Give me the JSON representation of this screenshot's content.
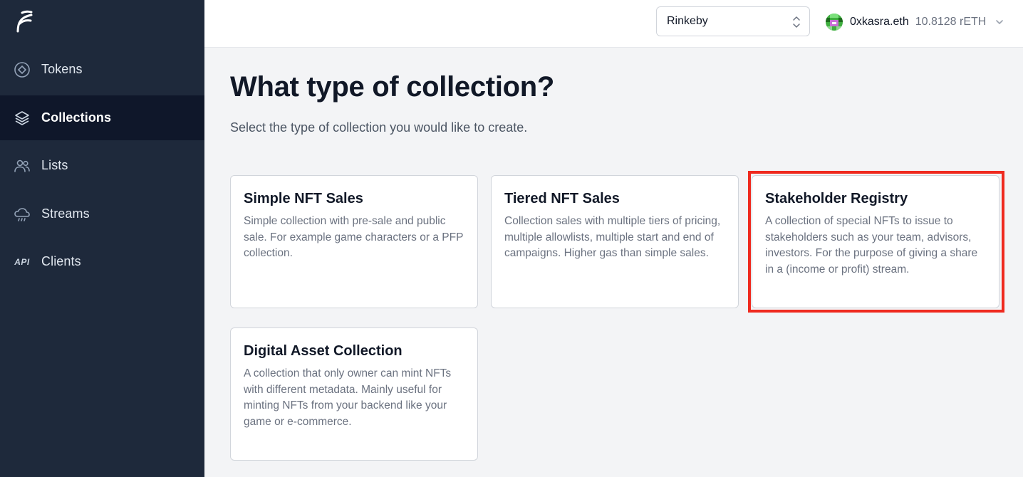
{
  "sidebar": {
    "items": [
      {
        "label": "Tokens",
        "icon": "token-icon",
        "active": false
      },
      {
        "label": "Collections",
        "icon": "layers-icon",
        "active": true
      },
      {
        "label": "Lists",
        "icon": "users-icon",
        "active": false
      },
      {
        "label": "Streams",
        "icon": "cloud-rain-icon",
        "active": false
      },
      {
        "label": "Clients",
        "icon": "api-icon",
        "active": false,
        "icon_text": "API"
      }
    ]
  },
  "header": {
    "network": "Rinkeby",
    "account_name": "0xkasra.eth",
    "balance": "10.8128 rETH"
  },
  "main": {
    "title": "What type of collection?",
    "subtitle": "Select the type of collection you would like to create.",
    "cards": [
      {
        "title": "Simple NFT Sales",
        "description": "Simple collection with pre-sale and public sale. For example game characters or a PFP collection."
      },
      {
        "title": "Tiered NFT Sales",
        "description": "Collection sales with multiple tiers of pricing, multiple allowlists, multiple start and end of campaigns. Higher gas than simple sales."
      },
      {
        "title": "Stakeholder Registry",
        "description": "A collection of special NFTs to issue to stakeholders such as your team, advisors, investors. For the purpose of giving a share in a (income or profit) stream.",
        "highlighted": true
      },
      {
        "title": "Digital Asset Collection",
        "description": "A collection that only owner can mint NFTs with different metadata. Mainly useful for minting NFTs from your backend like your game or e-commerce."
      }
    ]
  },
  "colors": {
    "sidebar_bg": "#1e293b",
    "sidebar_active_bg": "#0f172a",
    "highlight": "#ef2a1f"
  }
}
